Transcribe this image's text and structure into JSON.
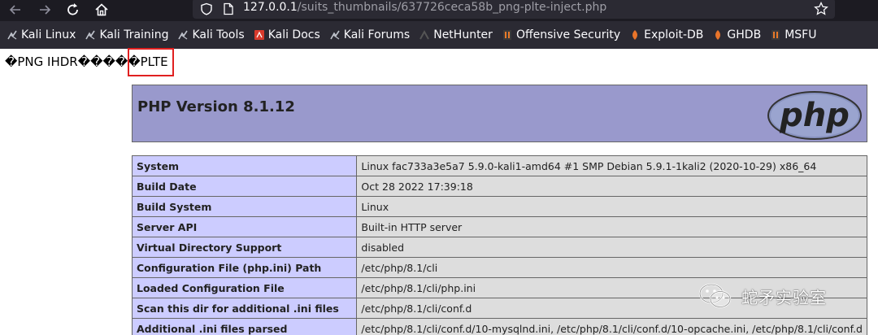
{
  "browser": {
    "url_host": "127.0.0.1",
    "url_path": "/suits_thumbnails/637726ceca58b_png-plte-inject.php",
    "bookmarks": [
      {
        "label": "Kali Linux",
        "icon": "kali-dragon-icon"
      },
      {
        "label": "Kali Training",
        "icon": "kali-dragon-icon"
      },
      {
        "label": "Kali Tools",
        "icon": "kali-dragon-icon"
      },
      {
        "label": "Kali Docs",
        "icon": "kali-docs-icon"
      },
      {
        "label": "Kali Forums",
        "icon": "kali-dragon-icon"
      },
      {
        "label": "NetHunter",
        "icon": "nethunter-icon"
      },
      {
        "label": "Offensive Security",
        "icon": "offsec-icon"
      },
      {
        "label": "Exploit-DB",
        "icon": "exploitdb-icon"
      },
      {
        "label": "GHDB",
        "icon": "ghdb-icon"
      },
      {
        "label": "MSFU",
        "icon": "offsec-icon"
      }
    ]
  },
  "page": {
    "raw_prefix": "�PNG  IHDR����",
    "raw_highlight": "�PLTE",
    "highlight_color": "#e02020"
  },
  "phpinfo": {
    "title": "PHP Version 8.1.12",
    "logo_text": "php",
    "header_color": "#9999cc",
    "key_color": "#ccccff",
    "value_color": "#dddddd",
    "rows": [
      {
        "key": "System",
        "value": "Linux fac733a3e5a7 5.9.0-kali1-amd64 #1 SMP Debian 5.9.1-1kali2 (2020-10-29) x86_64"
      },
      {
        "key": "Build Date",
        "value": "Oct 28 2022 17:39:18"
      },
      {
        "key": "Build System",
        "value": "Linux"
      },
      {
        "key": "Server API",
        "value": "Built-in HTTP server"
      },
      {
        "key": "Virtual Directory Support",
        "value": "disabled"
      },
      {
        "key": "Configuration File (php.ini) Path",
        "value": "/etc/php/8.1/cli"
      },
      {
        "key": "Loaded Configuration File",
        "value": "/etc/php/8.1/cli/php.ini"
      },
      {
        "key": "Scan this dir for additional .ini files",
        "value": "/etc/php/8.1/cli/conf.d"
      },
      {
        "key": "Additional .ini files parsed",
        "value": "/etc/php/8.1/cli/conf.d/10-mysqlnd.ini, /etc/php/8.1/cli/conf.d/10-opcache.ini, /etc/php/8.1/cli/conf.d"
      }
    ]
  },
  "watermark": {
    "text": "蛇矛实验室",
    "icon": "wechat-icon"
  }
}
